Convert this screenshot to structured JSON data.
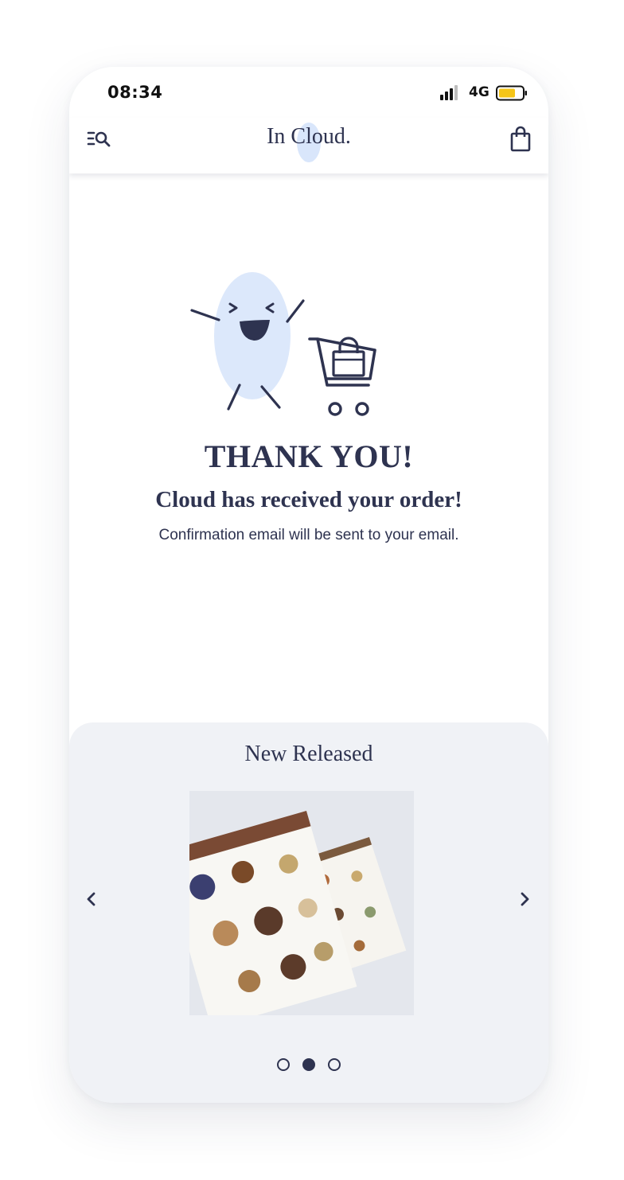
{
  "status_bar": {
    "time": "08:34",
    "network": "4G",
    "battery_color": "#f5c518"
  },
  "header": {
    "logo_text": "In Cloud.",
    "menu_icon": "menu-search-icon",
    "cart_icon": "shopping-bag-icon",
    "logo_blob_color": "#d9e6fb"
  },
  "confirmation": {
    "title": "THANK YOU!",
    "subtitle": "Cloud has received your order!",
    "note": "Confirmation email will be sent to your email."
  },
  "new_released": {
    "title": "New Released",
    "prev_icon": "chevron-left-icon",
    "next_icon": "chevron-right-icon",
    "active_slide": 2,
    "slide_count": 3
  },
  "colors": {
    "primary_text": "#2e3350",
    "section_bg": "#f0f2f6",
    "cloud_blue": "#dce8fb"
  }
}
